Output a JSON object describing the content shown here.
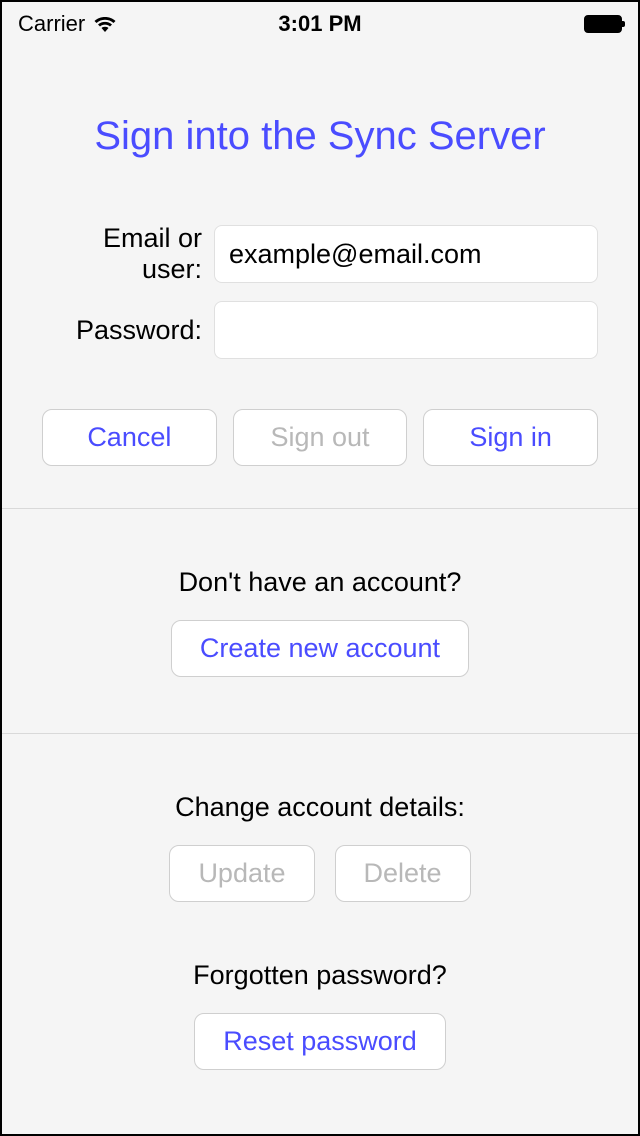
{
  "status_bar": {
    "carrier": "Carrier",
    "time": "3:01 PM"
  },
  "page": {
    "title": "Sign into the Sync Server"
  },
  "form": {
    "email_label": "Email or user:",
    "email_value": "example@email.com",
    "password_label": "Password:",
    "password_value": ""
  },
  "buttons": {
    "cancel": "Cancel",
    "sign_out": "Sign out",
    "sign_in": "Sign in",
    "create_account": "Create new account",
    "update": "Update",
    "delete": "Delete",
    "reset_password": "Reset password"
  },
  "prompts": {
    "no_account": "Don't have an account?",
    "change_details": "Change account details:",
    "forgot_password": "Forgotten password?"
  },
  "colors": {
    "accent": "#4a4cff",
    "disabled": "#b8b8b8"
  }
}
